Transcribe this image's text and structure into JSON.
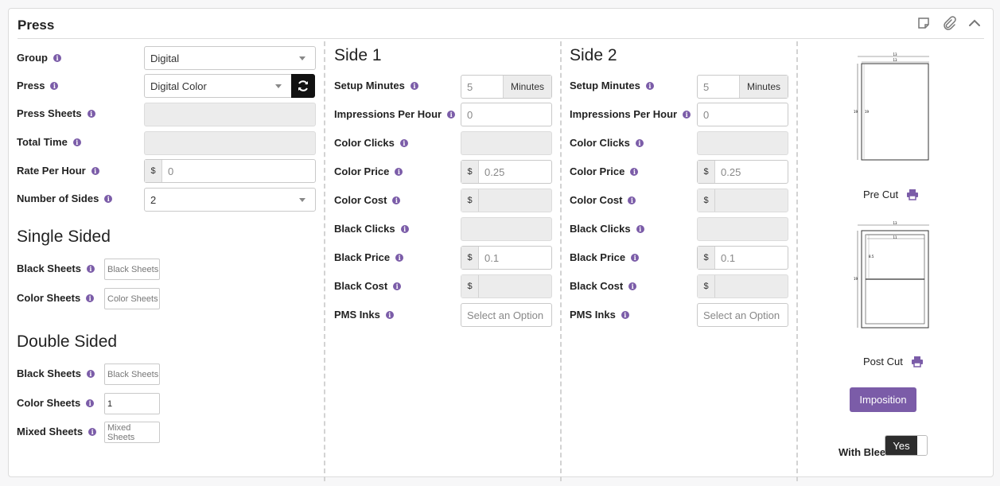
{
  "panel": {
    "title": "Press"
  },
  "left": {
    "group": {
      "label": "Group",
      "value": "Digital"
    },
    "press": {
      "label": "Press",
      "value": "Digital Color"
    },
    "press_sheets": {
      "label": "Press Sheets",
      "value": ""
    },
    "total_time": {
      "label": "Total Time",
      "value": ""
    },
    "rate_per_hour": {
      "label": "Rate Per Hour",
      "prefix": "$",
      "placeholder": "0"
    },
    "number_of_sides": {
      "label": "Number of Sides",
      "value": "2"
    },
    "single_sided": {
      "title": "Single Sided",
      "black_sheets": {
        "label": "Black Sheets",
        "placeholder": "Black Sheets"
      },
      "color_sheets": {
        "label": "Color Sheets",
        "placeholder": "Color Sheets"
      }
    },
    "double_sided": {
      "title": "Double Sided",
      "black_sheets": {
        "label": "Black Sheets",
        "placeholder": "Black Sheets"
      },
      "color_sheets": {
        "label": "Color Sheets",
        "value": "1"
      },
      "mixed_sheets": {
        "label": "Mixed Sheets",
        "placeholder": "Mixed Sheets"
      }
    }
  },
  "side1": {
    "title": "Side 1",
    "setup_minutes": {
      "label": "Setup Minutes",
      "placeholder": "5",
      "suffix": "Minutes"
    },
    "impressions_per_hour": {
      "label": "Impressions Per Hour",
      "placeholder": "0"
    },
    "color_clicks": {
      "label": "Color Clicks"
    },
    "color_price": {
      "label": "Color Price",
      "prefix": "$",
      "placeholder": "0.25"
    },
    "color_cost": {
      "label": "Color Cost",
      "prefix": "$"
    },
    "black_clicks": {
      "label": "Black Clicks"
    },
    "black_price": {
      "label": "Black Price",
      "prefix": "$",
      "placeholder": "0.1"
    },
    "black_cost": {
      "label": "Black Cost",
      "prefix": "$"
    },
    "pms_inks": {
      "label": "PMS Inks",
      "placeholder": "Select an Option"
    }
  },
  "side2": {
    "title": "Side 2",
    "setup_minutes": {
      "label": "Setup Minutes",
      "placeholder": "5",
      "suffix": "Minutes"
    },
    "impressions_per_hour": {
      "label": "Impressions Per Hour",
      "placeholder": "0"
    },
    "color_clicks": {
      "label": "Color Clicks"
    },
    "color_price": {
      "label": "Color Price",
      "prefix": "$",
      "placeholder": "0.25"
    },
    "color_cost": {
      "label": "Color Cost",
      "prefix": "$"
    },
    "black_clicks": {
      "label": "Black Clicks"
    },
    "black_price": {
      "label": "Black Price",
      "prefix": "$",
      "placeholder": "0.1"
    },
    "black_cost": {
      "label": "Black Cost",
      "prefix": "$"
    },
    "pms_inks": {
      "label": "PMS Inks",
      "placeholder": "Select an Option"
    }
  },
  "preview": {
    "pre_cut": {
      "caption": "Pre Cut",
      "width_label": "13",
      "inner_width_label": "13",
      "height_label": "19",
      "inner_height_label": "19"
    },
    "post_cut": {
      "caption": "Post Cut",
      "width_label": "13",
      "inner_width_label": "11",
      "height_label": "19",
      "inner_height_label": "8.5"
    },
    "imposition_button": "Imposition",
    "with_bleed": {
      "label": "With Bleed",
      "value": "Yes"
    }
  },
  "icons": {
    "header": [
      "note-icon",
      "paperclip-icon",
      "chevron-up-icon"
    ],
    "print": "printer-icon",
    "refresh": "refresh-icon",
    "info": "info-icon"
  },
  "colors": {
    "accent": "#7b5ca8",
    "dark": "#2d2d2d"
  }
}
